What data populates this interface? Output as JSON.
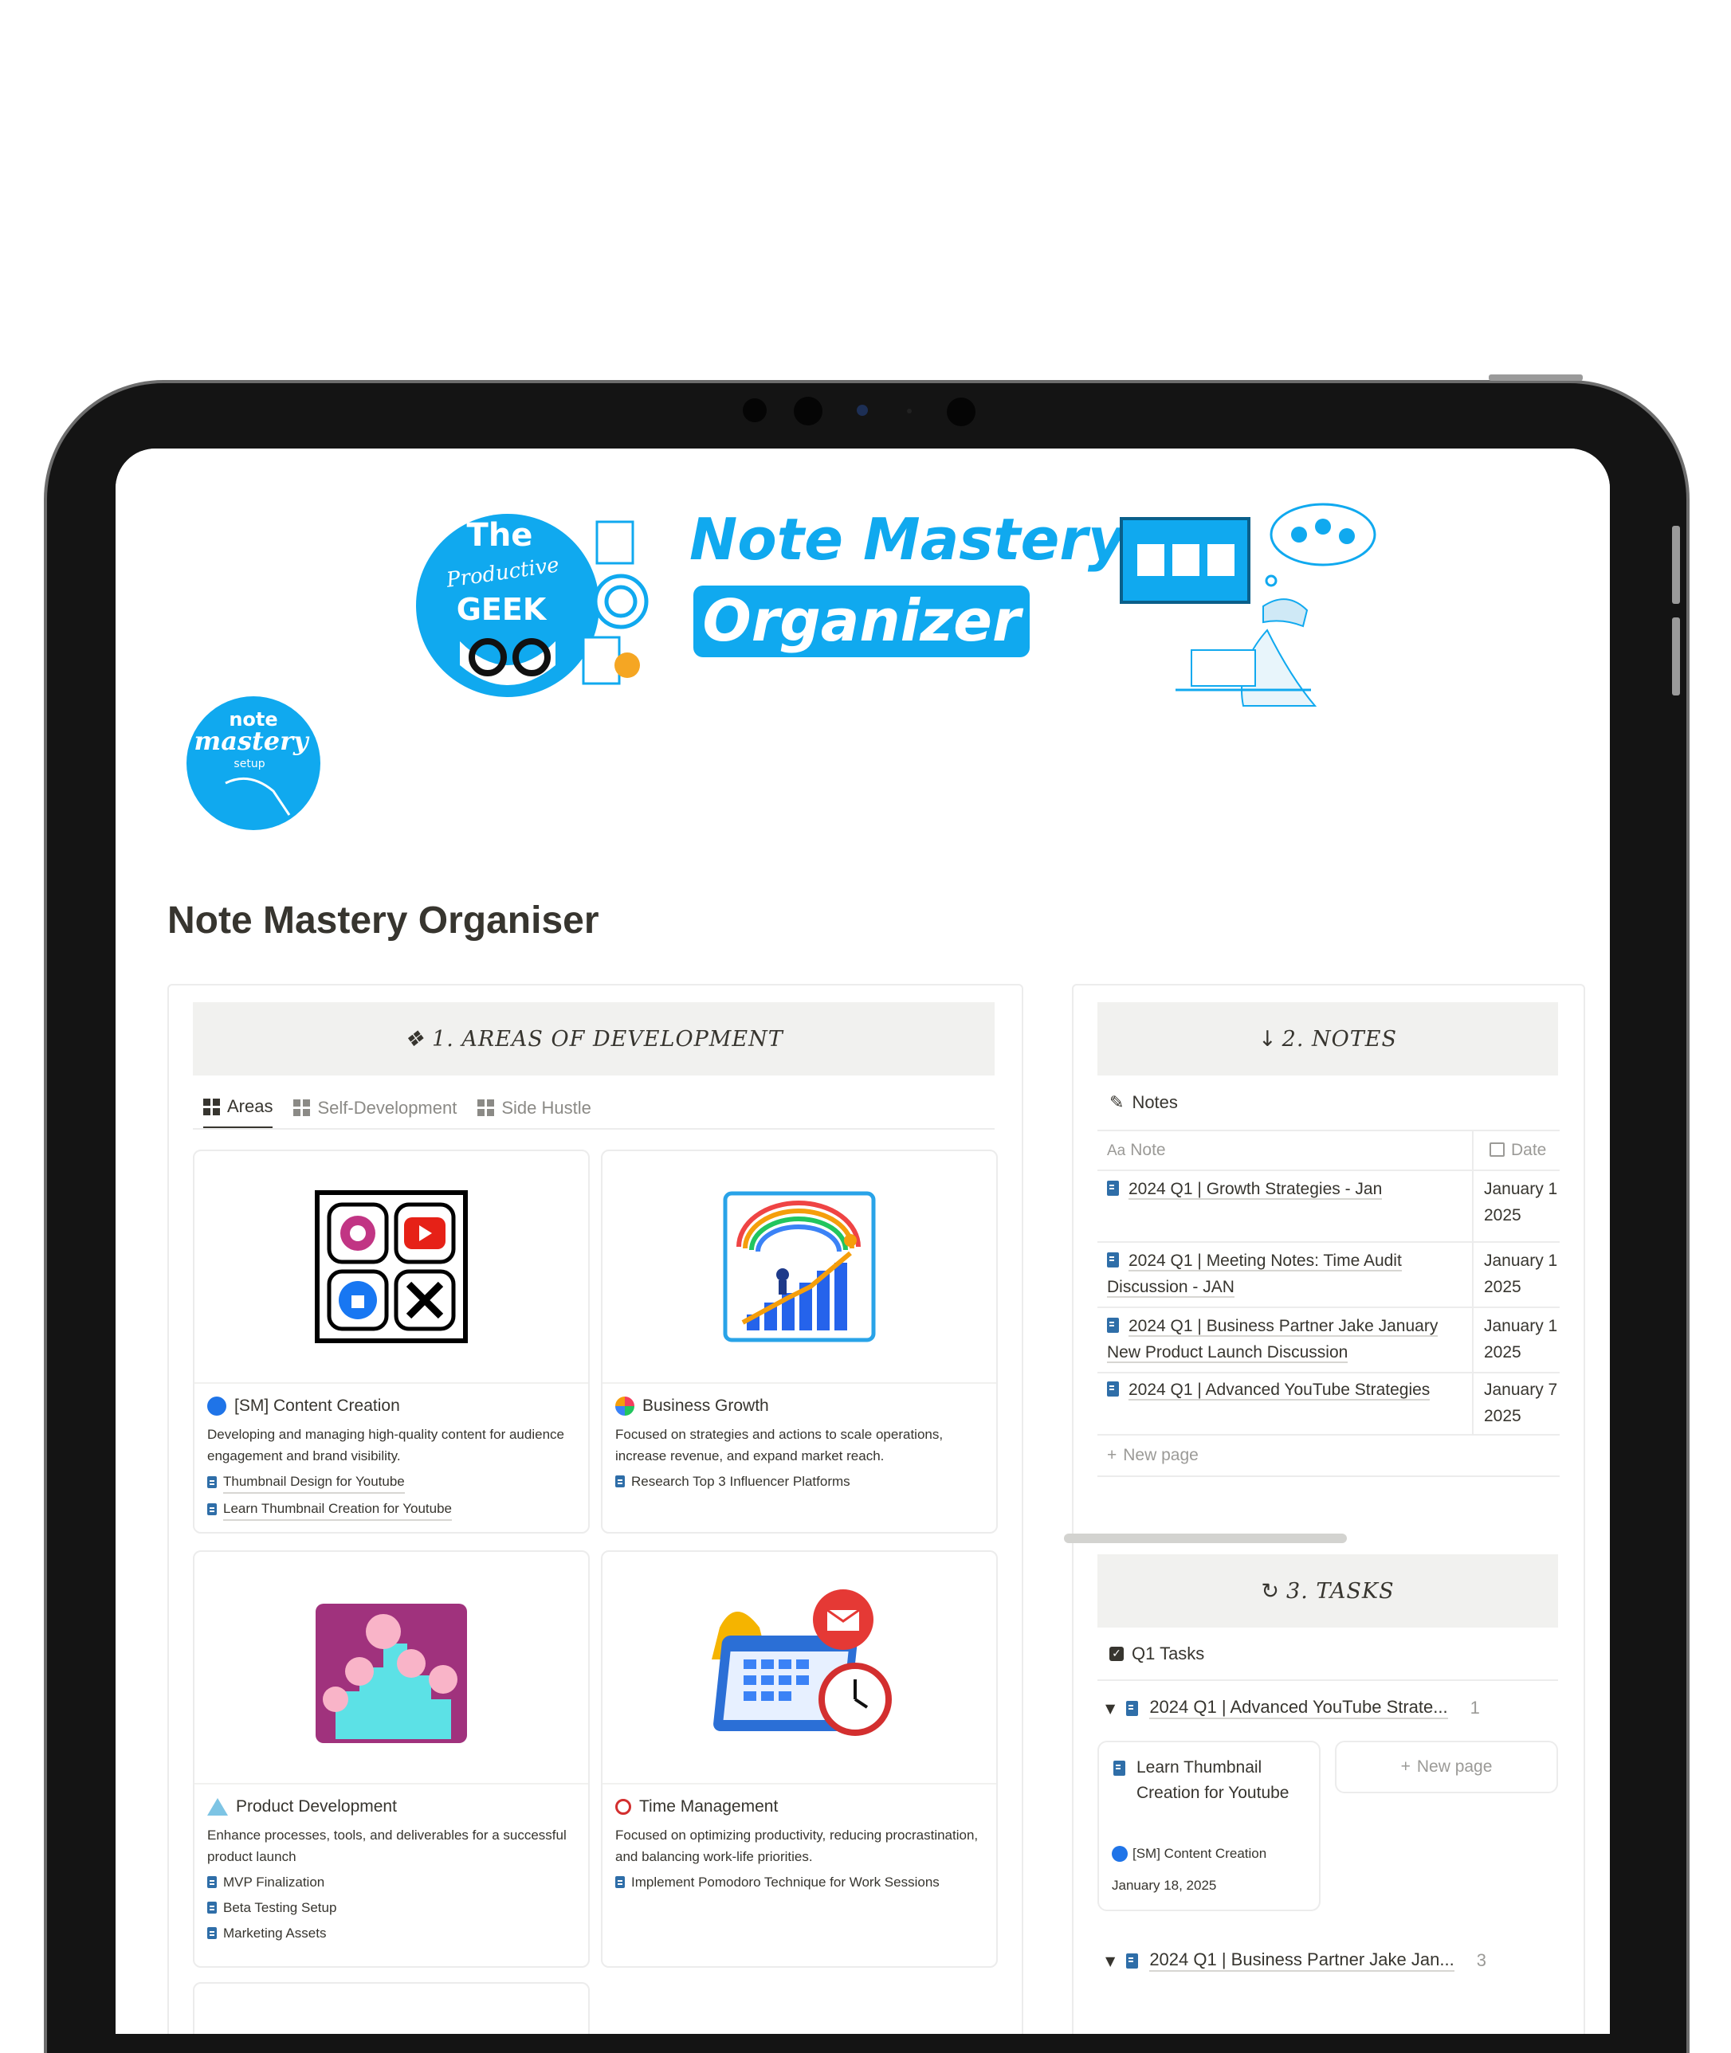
{
  "cover": {
    "logo_the": "The",
    "logo_productive": "Productive",
    "logo_geek": "GEEK",
    "banner_line1": "Note Mastery",
    "banner_line2": "Organizer",
    "page_icon_line1": "note",
    "page_icon_line2": "mastery",
    "page_icon_line3": "setup"
  },
  "page": {
    "title": "Note Mastery Organiser"
  },
  "areas": {
    "header": "❖ 1. AREAS OF DEVELOPMENT",
    "tabs": [
      {
        "label": "Areas"
      },
      {
        "label": "Self-Development"
      },
      {
        "label": "Side Hustle"
      }
    ],
    "cards": [
      {
        "title": "[SM] Content Creation",
        "desc": "Developing and managing high-quality content for audience engagement and brand visibility.",
        "links": [
          "Thumbnail Design for Youtube",
          "Learn Thumbnail Creation for Youtube"
        ]
      },
      {
        "title": "Business Growth",
        "desc": "Focused on strategies and actions to scale operations, increase revenue, and expand market reach.",
        "links": [
          "Research Top 3 Influencer Platforms"
        ]
      },
      {
        "title": "Product Development",
        "desc": "Enhance processes, tools, and deliverables for a successful product launch",
        "links": [
          "MVP Finalization",
          "Beta Testing Setup",
          "Marketing Assets"
        ]
      },
      {
        "title": "Time Management",
        "desc": "Focused on optimizing productivity, reducing procrastination, and balancing work-life priorities.",
        "links": [
          "Implement Pomodoro Technique for Work Sessions"
        ]
      }
    ]
  },
  "notes": {
    "header": "2. NOTES",
    "view_label": "Notes",
    "col_note": "Note",
    "col_note_prefix": "Aa",
    "col_date": "Date",
    "rows": [
      {
        "note": "2024 Q1 | Growth Strategies - Jan",
        "date": "January 1 2025"
      },
      {
        "note": "2024 Q1 | Meeting Notes: Time Audit Discussion - JAN",
        "date": "January 1 2025"
      },
      {
        "note": "2024 Q1 | Business Partner Jake January New Product Launch Discussion",
        "date": "January 1 2025"
      },
      {
        "note": "2024 Q1 | Advanced YouTube Strategies",
        "date": "January 7 2025"
      }
    ],
    "new_page": "New page"
  },
  "tasks": {
    "header": "3. TASKS",
    "view_label": "Q1 Tasks",
    "groups": [
      {
        "title": "2024 Q1 | Advanced YouTube Strate...",
        "count": "1"
      },
      {
        "title": "2024 Q1 | Business Partner Jake Jan...",
        "count": "3"
      }
    ],
    "card": {
      "title": "Learn Thumbnail Creation for Youtube",
      "area": "[SM] Content Creation",
      "date": "January 18, 2025"
    },
    "new_page": "New page"
  },
  "colors": {
    "brand_blue": "#10a9ef",
    "text": "#37352f",
    "header_bg": "#f1f1ef",
    "doc_icon": "#2f6ea8"
  }
}
